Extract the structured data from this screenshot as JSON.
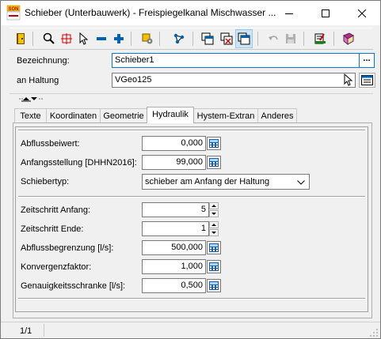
{
  "window": {
    "title": "Schieber (Unterbauwerk) - Freispiegelkanal Mischwasser ...",
    "app_badge": "SON",
    "controls": [
      "minimize-icon",
      "maximize-icon",
      "close-icon"
    ]
  },
  "toolbar": {
    "icons": [
      "exit-icon",
      "zoom-icon",
      "crosshair-icon",
      "select-arrow-icon",
      "minus-icon",
      "plus-icon",
      "settings-icon",
      "network-icon",
      "window-stack-icon",
      "window-close-icon",
      "window-copy-icon",
      "undo-icon",
      "save-icon",
      "edit-icon",
      "book-icon"
    ],
    "pressed": "window-copy-icon"
  },
  "header": {
    "bezeichnung_label": "Bezeichnung:",
    "bezeichnung_value": "Schieber1",
    "ellipsis": "...",
    "haltung_label": "an Haltung",
    "haltung_value": "VGeo125"
  },
  "tabs": [
    "Texte",
    "Koordinaten",
    "Geometrie",
    "Hydraulik",
    "Hystem-Extran",
    "Anderes"
  ],
  "active_tab": "Hydraulik",
  "form": {
    "abfluss_label": "Abflussbeiwert:",
    "abfluss_value": "0,000",
    "anfang_label": "Anfangsstellung [DHHN2016]:",
    "anfang_value": "99,000",
    "typ_label": "Schiebertyp:",
    "typ_value": "schieber am Anfang der Haltung",
    "zs_anfang_label": "Zeitschritt Anfang:",
    "zs_anfang_value": "5",
    "zs_ende_label": "Zeitschritt Ende:",
    "zs_ende_value": "1",
    "begrenzung_label": "Abflussbegrenzung [l/s]:",
    "begrenzung_value": "500,000",
    "konvergenz_label": "Konvergenzfaktor:",
    "konvergenz_value": "1,000",
    "genauigkeit_label": "Genauigkeitsschranke [l/s]:",
    "genauigkeit_value": "0,500"
  },
  "status": {
    "record": "1/1"
  },
  "colors": {
    "accent": "#0078d7",
    "pressed_bg": "#cce4f7",
    "icon_blue": "#0063b1",
    "icon_red": "#d00000"
  }
}
